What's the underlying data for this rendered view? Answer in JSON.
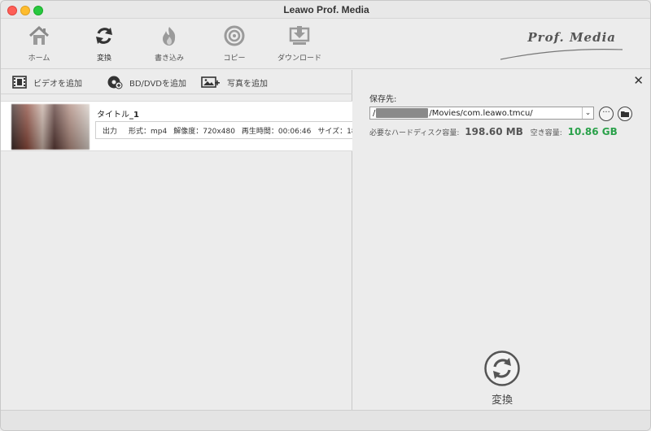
{
  "window": {
    "title": "Leawo Prof. Media"
  },
  "toolbar": {
    "items": [
      {
        "label": "ホーム",
        "icon": "home-icon"
      },
      {
        "label": "変換",
        "icon": "convert-icon"
      },
      {
        "label": "書き込み",
        "icon": "burn-icon"
      },
      {
        "label": "コピー",
        "icon": "copy-disc-icon"
      },
      {
        "label": "ダウンロード",
        "icon": "download-icon"
      }
    ],
    "brand": "Prof. Media"
  },
  "add_bar": {
    "add_video": "ビデオを追加",
    "add_bd_dvd": "BD/DVDを追加",
    "add_photo": "写真を追加"
  },
  "files": [
    {
      "title_prefix": "タイトル",
      "title_suffix": "_1",
      "output_label": "出力",
      "format": "形式：mp4",
      "resolution": "解像度：720x480",
      "duration": "再生時間：00:06:46",
      "size": "サイズ：18"
    }
  ],
  "settings": {
    "save_to_label": "保存先:",
    "path_prefix": "/",
    "path_suffix": "/Movies/com.leawo.tmcu/",
    "required_label": "必要なハードディスク容量:",
    "required_value": "198.60 MB",
    "free_label": "空き容量:",
    "free_value": "10.86 GB",
    "convert_label": "変換"
  },
  "colors": {
    "free_space": "#2aa14a",
    "close_button": "#fe5f57",
    "minimize_button": "#febc2e",
    "maximize_button": "#28c840"
  }
}
